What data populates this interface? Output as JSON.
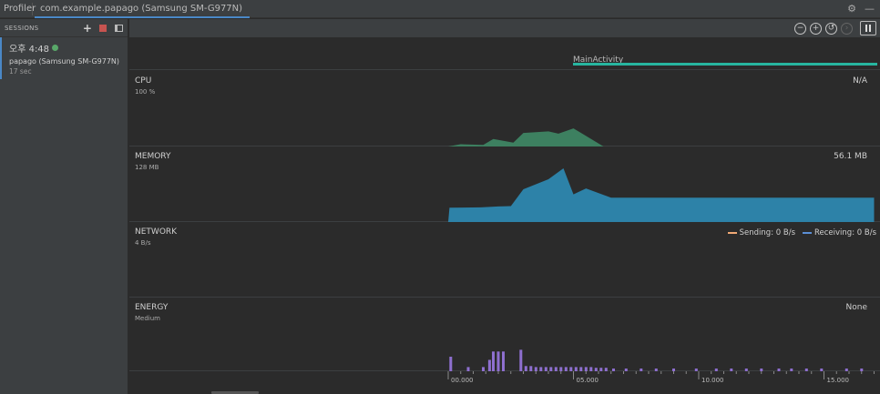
{
  "tabs": {
    "profiler": "Profiler",
    "active": "com.example.papago (Samsung SM-G977N)"
  },
  "icons": {
    "settings": "gear-icon",
    "minimize": "minimize-icon",
    "zoom_out": "zoom-out-icon",
    "zoom_in": "zoom-in-icon",
    "reset_zoom": "reset-zoom-icon",
    "jump_live": "jump-to-live-icon",
    "pause": "pause-icon"
  },
  "sessions": {
    "header": "SESSIONS",
    "items": [
      {
        "time": "오후 4:48",
        "name": "papago (Samsung SM-G977N)",
        "duration": "17 sec",
        "live": true
      }
    ]
  },
  "colors": {
    "accent": "#4a88c7",
    "activity": "#27b6a0",
    "cpu": "#3d8060",
    "memory": "#2d82a8",
    "energy": "#8e6fcf",
    "sending": "#f0a975",
    "receiving": "#5b8fd6",
    "live_dot": "#59a869"
  },
  "activity": {
    "label": "MainActivity"
  },
  "monitors": {
    "cpu": {
      "title": "CPU",
      "scale": "100 %",
      "value": "N/A"
    },
    "memory": {
      "title": "MEMORY",
      "scale": "128 MB",
      "value": "56.1 MB"
    },
    "network": {
      "title": "NETWORK",
      "scale": "4 B/s",
      "sending": "Sending: 0 B/s",
      "receiving": "Receiving: 0 B/s"
    },
    "energy": {
      "title": "ENERGY",
      "scale": "Medium",
      "value": "None"
    }
  },
  "axis": {
    "ticks": [
      {
        "label": "00.000",
        "sec": 0
      },
      {
        "label": "05.000",
        "sec": 5
      },
      {
        "label": "10.000",
        "sec": 10
      },
      {
        "label": "15.000",
        "sec": 15
      }
    ]
  },
  "chart_data": [
    {
      "type": "area",
      "name": "CPU usage (%)",
      "x": [
        0,
        0.5,
        1.4,
        1.8,
        2.6,
        3,
        4,
        4.4,
        5,
        5.5,
        6.2
      ],
      "y": [
        0,
        3,
        2,
        10,
        5,
        18,
        20,
        17,
        24,
        14,
        0
      ],
      "ylim": [
        0,
        100
      ]
    },
    {
      "type": "area",
      "name": "Memory (MB)",
      "x": [
        0,
        0.05,
        1.3,
        2,
        2.5,
        3,
        4,
        4.6,
        5,
        5.5,
        6.5,
        17
      ],
      "y": [
        0,
        34,
        35,
        37,
        38,
        78,
        102,
        128,
        66,
        80,
        58,
        58
      ],
      "ylim": [
        0,
        128
      ]
    },
    {
      "type": "bar",
      "name": "Energy",
      "x": [
        0.1,
        0.8,
        1.4,
        1.65,
        1.8,
        2,
        2.2,
        2.9,
        3.1,
        3.3,
        3.5,
        3.7,
        3.9,
        4.1,
        4.3,
        4.5,
        4.7,
        4.9,
        5.1,
        5.3,
        5.5,
        5.7,
        5.9,
        6.1,
        6.3,
        6.6,
        7.1,
        7.7,
        8.3,
        9,
        9.9,
        10.7,
        11.3,
        11.9,
        12.5,
        13.2,
        13.7,
        14.3,
        14.9,
        15.9,
        16.5
      ],
      "y": [
        0.42,
        0.12,
        0.12,
        0.33,
        0.57,
        0.57,
        0.57,
        0.62,
        0.15,
        0.15,
        0.12,
        0.12,
        0.12,
        0.12,
        0.12,
        0.12,
        0.12,
        0.12,
        0.12,
        0.12,
        0.12,
        0.12,
        0.1,
        0.1,
        0.1,
        0.08,
        0.08,
        0.08,
        0.08,
        0.08,
        0.08,
        0.08,
        0.08,
        0.08,
        0.08,
        0.08,
        0.08,
        0.08,
        0.08,
        0.08,
        0.08
      ],
      "ylim": [
        0,
        1.5
      ]
    }
  ]
}
